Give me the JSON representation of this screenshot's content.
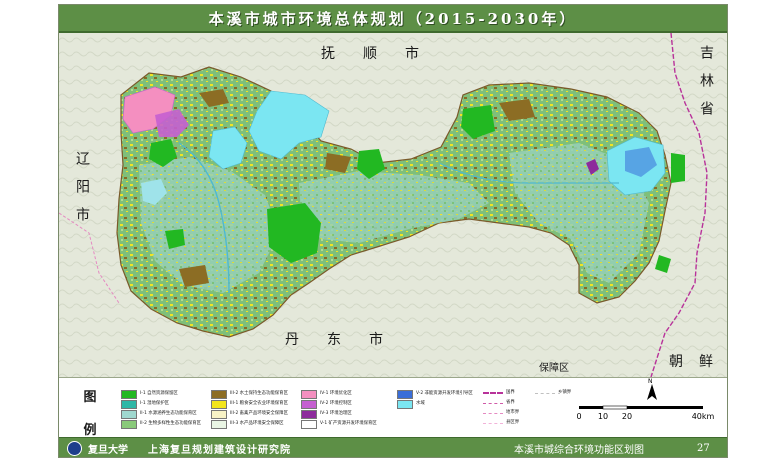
{
  "title": "本溪市城市环境总体规划（2015-2030年）",
  "surroundings": {
    "north": "抚顺市",
    "east": "吉林省",
    "west": "辽阳市",
    "south": "丹东市",
    "southeast": "朝鲜",
    "south_small": "保障区"
  },
  "legend": {
    "heading_1": "图",
    "heading_2": "例",
    "zones": [
      {
        "label": "I-1 自然资源保留区",
        "color": "#22b822"
      },
      {
        "label": "I-1 湿地保护区",
        "color": "#2fb7a6"
      },
      {
        "label": "II-1 水源涵养生态功能保育区",
        "color": "#9fd8cf"
      },
      {
        "label": "II-2 生物多样性生态功能保育区",
        "color": "#89c97a"
      },
      {
        "label": "III-2 水土保持生态功能保育区",
        "color": "#8c6d24"
      },
      {
        "label": "III-1 粮食安全农业环境保育区",
        "color": "#f3e51c"
      },
      {
        "label": "III-2 畜禽产品环境安全保障区",
        "color": "#f8f3c6"
      },
      {
        "label": "III-3 水产品环境安全保障区",
        "color": "#e9f5e4"
      },
      {
        "label": "IV-1 环境优化区",
        "color": "#f48fc0"
      },
      {
        "label": "IV-2 环境控制区",
        "color": "#c55fd0"
      },
      {
        "label": "IV-3 环境治理区",
        "color": "#8d2b9c"
      },
      {
        "label": "V-1 矿产资源开发环境保育区",
        "color": "#ffffff"
      },
      {
        "label": "V-2 非能资源开发环境引导区",
        "color": "#3a6ed8"
      },
      {
        "label": "水域",
        "color": "#7be6f2"
      }
    ],
    "boundaries": [
      {
        "label": "国界",
        "color": "#b8329a"
      },
      {
        "label": "省界",
        "color": "#d05aa8"
      },
      {
        "label": "地市界",
        "color": "#e58ac2"
      },
      {
        "label": "县区界",
        "color": "#f2b3d9"
      },
      {
        "label": "乡镇界",
        "color": "#c0c0c0"
      }
    ]
  },
  "north_arrow": "N",
  "scale": {
    "ticks": [
      "0",
      "10",
      "20",
      "40km"
    ]
  },
  "footer": {
    "university": "复旦大学",
    "institute": "上海复旦规划建筑设计研究院",
    "map_name": "本溪市城综合环境功能区划图",
    "page": "27"
  }
}
